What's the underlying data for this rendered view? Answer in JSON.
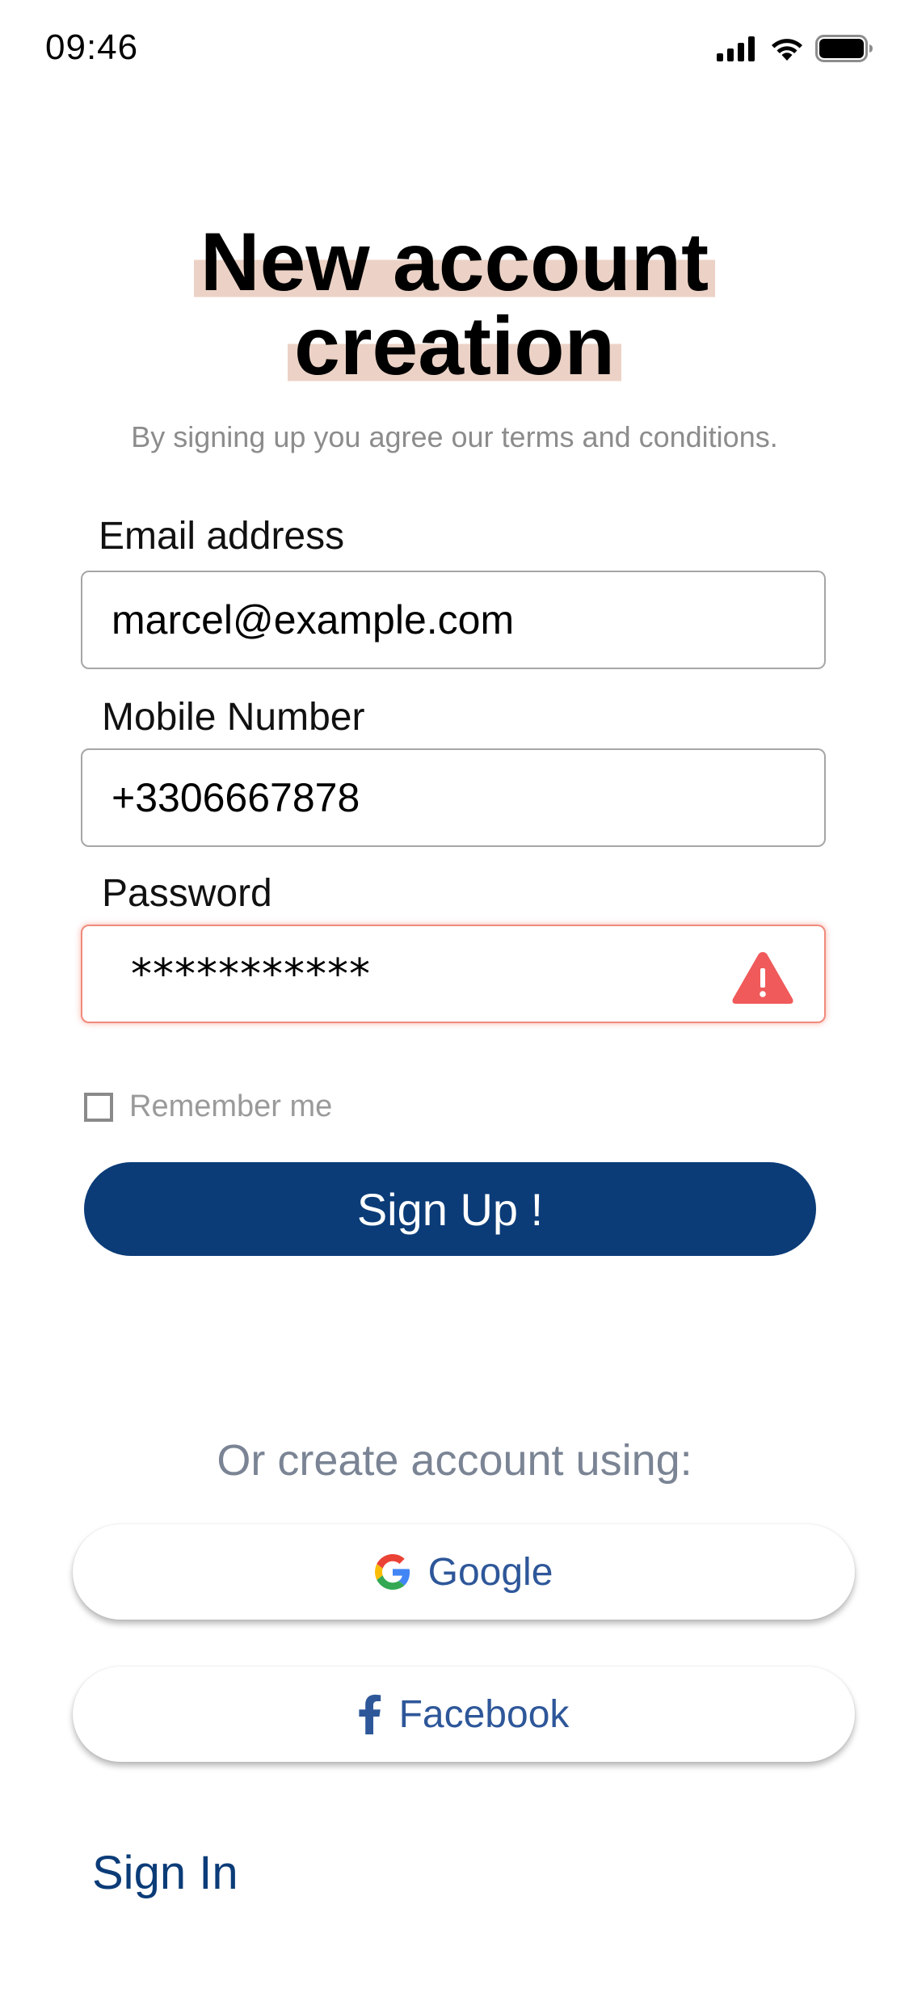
{
  "status_bar": {
    "time": "09:46",
    "icons": [
      "signal-icon",
      "wifi-icon",
      "battery-icon"
    ]
  },
  "header": {
    "title_line1": "New account",
    "title_line2": "creation",
    "subtitle": "By signing up you agree our terms and conditions.",
    "highlight_color": "#ecd2c6"
  },
  "form": {
    "email": {
      "label": "Email address",
      "value": "marcel@example.com"
    },
    "mobile": {
      "label": "Mobile Number",
      "value": "+3306667878"
    },
    "password": {
      "label": "Password",
      "masked_value": "***********",
      "state": "error",
      "status_icon": "warning-icon"
    },
    "remember_me": {
      "label": "Remember me",
      "checked": false
    },
    "submit_label": "Sign Up !"
  },
  "social": {
    "heading": "Or create account using:",
    "providers": [
      {
        "name": "Google",
        "icon": "google-icon"
      },
      {
        "name": "Facebook",
        "icon": "facebook-icon"
      }
    ]
  },
  "footer": {
    "sign_in_label": "Sign In"
  },
  "colors": {
    "primary": "#0b3c78",
    "error": "#f05a5a",
    "social_text": "#2e5799"
  }
}
